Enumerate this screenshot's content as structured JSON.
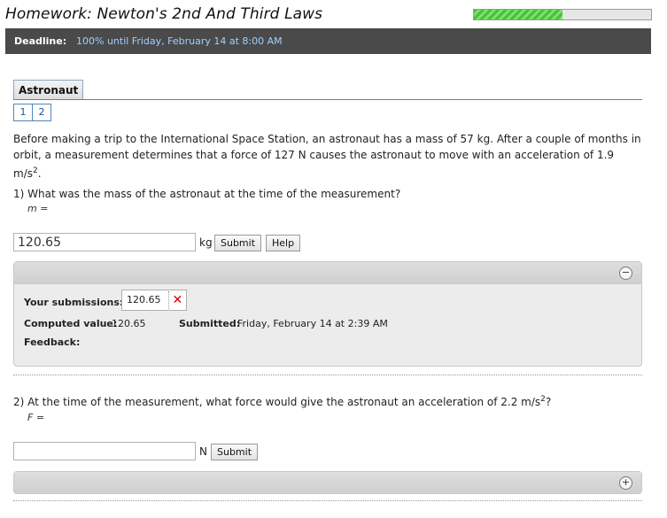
{
  "header": {
    "title": "Homework: Newton's 2nd And Third Laws",
    "progress_fraction": 0.5,
    "accent_color": "#47c13a"
  },
  "deadline": {
    "label": "Deadline:",
    "value": "100% until Friday, February 14 at 8:00 AM"
  },
  "problem": {
    "tab_label": "Astronaut",
    "pages": [
      "1",
      "2"
    ],
    "text_before": "Before making a trip to the International Space Station, an astronaut has a mass of 57 kg. After a couple of months in orbit, a measurement determines that a force of 127 N causes the astronaut to move with an acceleration of 1.9 m/s",
    "text_sup": "2",
    "text_after": "."
  },
  "q1": {
    "number": "1)",
    "question": "What was the mass of the astronaut at the time of the measurement?",
    "variable": "m =",
    "input_value": "120.65",
    "unit": "kg",
    "submit_label": "Submit",
    "help_label": "Help",
    "panel": {
      "toggle_icon": "minus-circle-icon",
      "your_submissions_label": "Your submissions:",
      "submission_value": "120.65",
      "submission_status_icon": "wrong-x-icon",
      "submission_status_glyph": "✕",
      "computed_label": "Computed value:",
      "computed_value": "120.65",
      "submitted_label": "Submitted:",
      "submitted_value": "Friday, February 14 at 2:39 AM",
      "feedback_label": "Feedback:"
    }
  },
  "q2": {
    "number": "2)",
    "question_before": "At the time of the measurement, what force would give the astronaut an acceleration of 2.2 m/s",
    "question_sup": "2",
    "question_after": "?",
    "variable": "F =",
    "input_value": "",
    "unit": "N",
    "submit_label": "Submit",
    "panel": {
      "toggle_icon": "plus-circle-icon"
    }
  }
}
